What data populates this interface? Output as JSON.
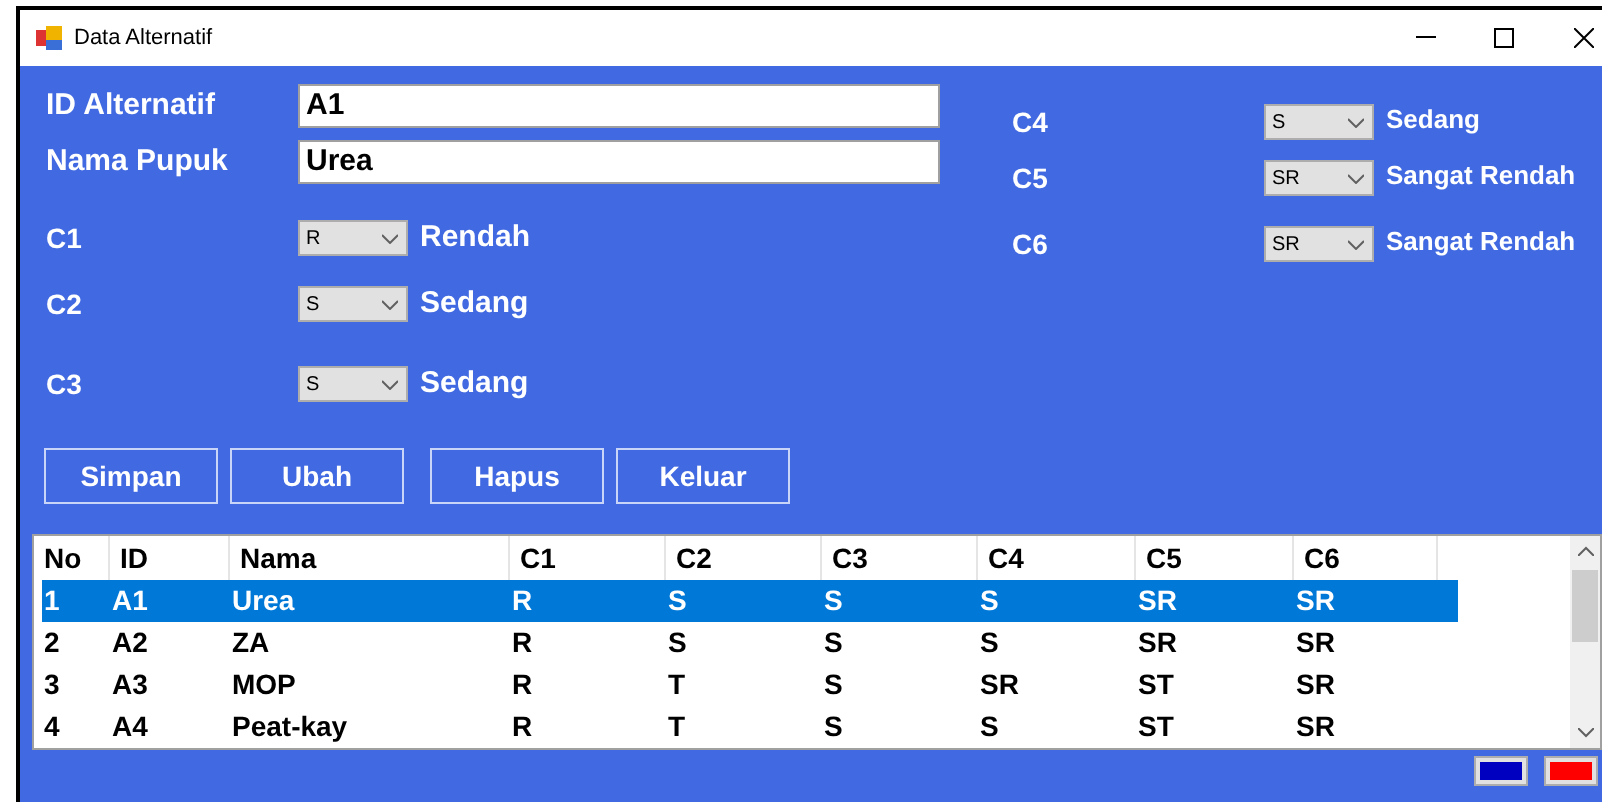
{
  "window": {
    "title": "Data Alternatif"
  },
  "fields": [
    {
      "label": "ID Alternatif",
      "value": "A1"
    },
    {
      "label": "Nama Pupuk",
      "value": "Urea"
    }
  ],
  "criteria": [
    {
      "label": "C1",
      "value": "R",
      "description": "Rendah"
    },
    {
      "label": "C2",
      "value": "S",
      "description": "Sedang"
    },
    {
      "label": "C3",
      "value": "S",
      "description": "Sedang"
    },
    {
      "label": "C4",
      "value": "S",
      "description": "Sedang"
    },
    {
      "label": "C5",
      "value": "SR",
      "description": "Sangat Rendah"
    },
    {
      "label": "C6",
      "value": "SR",
      "description": "Sangat Rendah"
    }
  ],
  "buttons": [
    "Simpan",
    "Ubah",
    "Hapus",
    "Keluar"
  ],
  "table": {
    "columns": [
      "No",
      "ID",
      "Nama",
      "C1",
      "C2",
      "C3",
      "C4",
      "C5",
      "C6"
    ],
    "rows": [
      {
        "selected": true,
        "cells": [
          "1",
          "A1",
          "Urea",
          "R",
          "S",
          "S",
          "S",
          "SR",
          "SR"
        ]
      },
      {
        "selected": false,
        "cells": [
          "2",
          "A2",
          "ZA",
          "R",
          "S",
          "S",
          "S",
          "SR",
          "SR"
        ]
      },
      {
        "selected": false,
        "cells": [
          "3",
          "A3",
          "MOP",
          "R",
          "T",
          "S",
          "SR",
          "ST",
          "SR"
        ]
      },
      {
        "selected": false,
        "cells": [
          "4",
          "A4",
          "Peat-kay",
          "R",
          "T",
          "S",
          "S",
          "ST",
          "SR"
        ]
      }
    ]
  },
  "color_buttons": [
    {
      "color": "#0000c0"
    },
    {
      "color": "#ff0000"
    }
  ]
}
